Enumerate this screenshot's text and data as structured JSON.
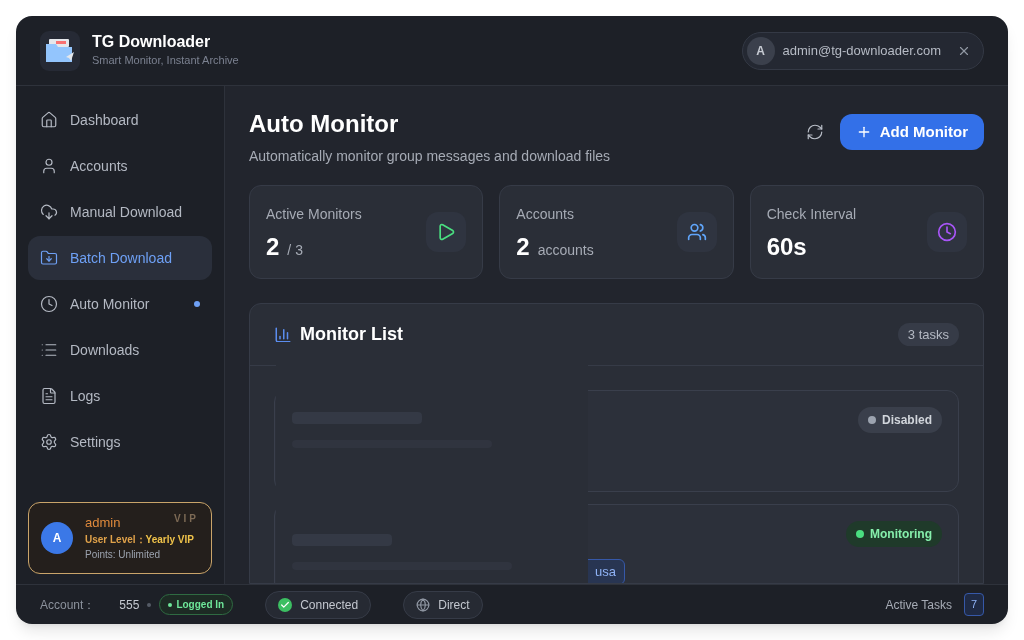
{
  "app": {
    "name": "TG Downloader",
    "tagline": "Smart Monitor, Instant Archive"
  },
  "user_chip": {
    "avatar": "A",
    "email": "admin@tg-downloader.com"
  },
  "nav": [
    {
      "label": "Dashboard",
      "selected": false,
      "dot": false
    },
    {
      "label": "Accounts",
      "selected": false,
      "dot": false
    },
    {
      "label": "Manual Download",
      "selected": false,
      "dot": false
    },
    {
      "label": "Batch Download",
      "selected": true,
      "dot": false
    },
    {
      "label": "Auto Monitor",
      "selected": false,
      "dot": true
    },
    {
      "label": "Downloads",
      "selected": false,
      "dot": false
    },
    {
      "label": "Logs",
      "selected": false,
      "dot": false
    },
    {
      "label": "Settings",
      "selected": false,
      "dot": false
    }
  ],
  "vip_card": {
    "avatar": "A",
    "name": "admin",
    "tag": "VIP",
    "level_label": "User Level：",
    "level_value": "Yearly VIP",
    "points": "Points: Unlimited"
  },
  "page": {
    "title": "Auto Monitor",
    "subtitle": "Automatically monitor group messages and download files",
    "add_button": "Add Monitor"
  },
  "stats": [
    {
      "label": "Active Monitors",
      "value": "2",
      "unit": "/ 3",
      "color": "#4ade80"
    },
    {
      "label": "Accounts",
      "value": "2",
      "unit": "accounts",
      "color": "#60a5fa"
    },
    {
      "label": "Check Interval",
      "value": "60s",
      "color": "#a855f7"
    }
  ],
  "monitor_list": {
    "title": "Monitor List",
    "count": "3 tasks",
    "items": [
      {
        "status": "Disabled",
        "kind": "disabled"
      },
      {
        "status": "Monitoring",
        "kind": "monitoring",
        "tag": "usa"
      }
    ]
  },
  "status_bar": {
    "account_label": "Account：",
    "account_value": "555",
    "login": "Logged In",
    "connection": "Connected",
    "proxy": "Direct",
    "active_tasks_label": "Active Tasks",
    "active_tasks": "7"
  }
}
